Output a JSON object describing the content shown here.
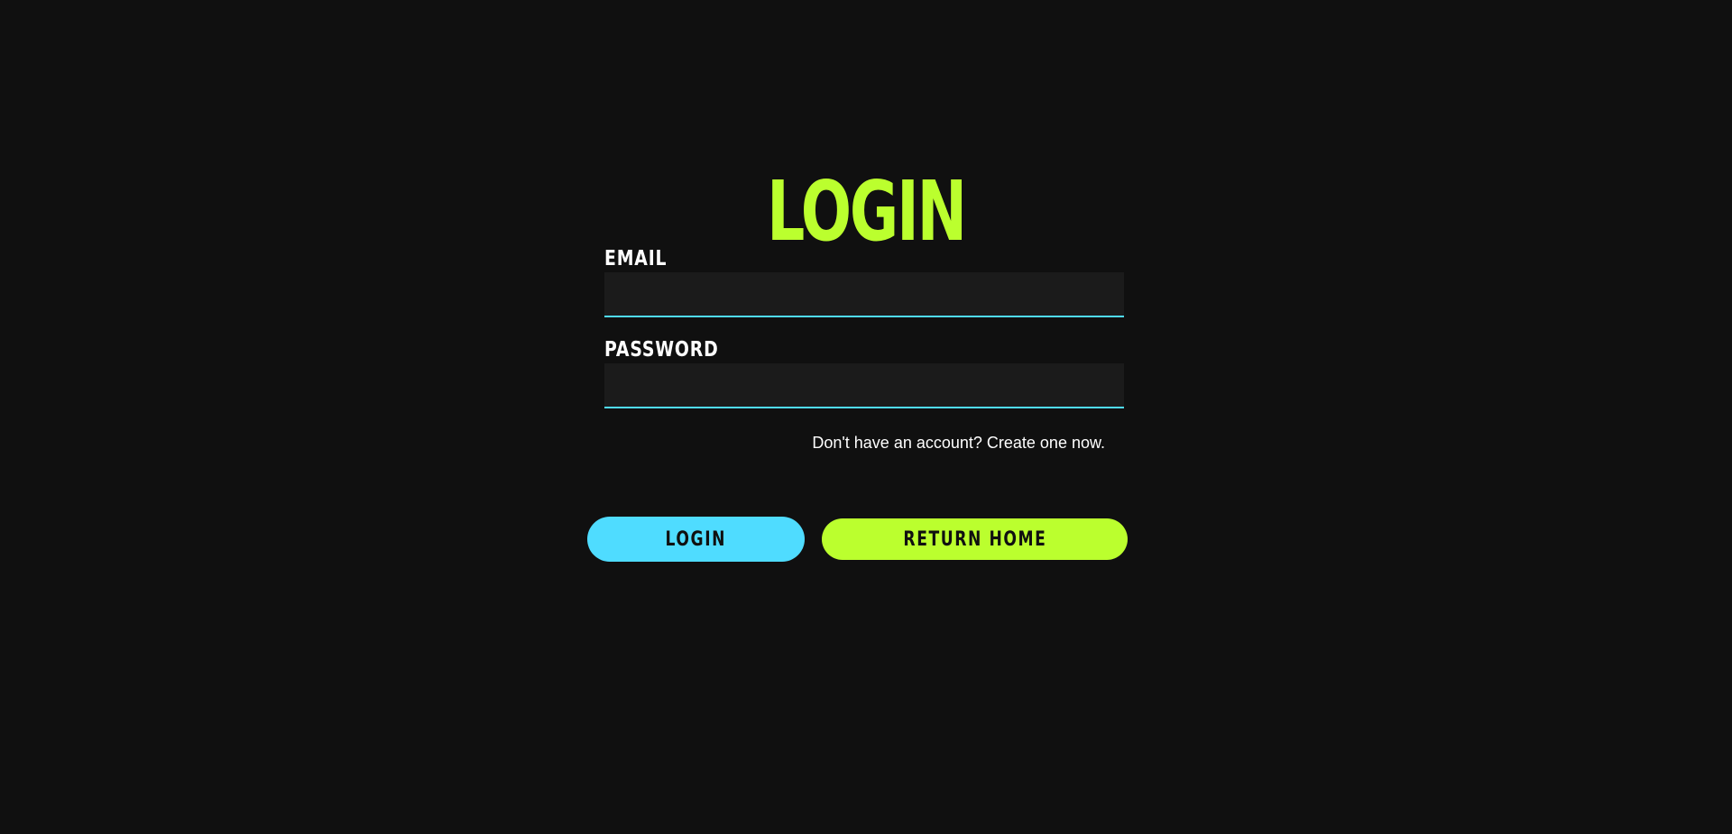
{
  "page": {
    "title": "LOGIN"
  },
  "form": {
    "email": {
      "label": "EMAIL",
      "value": "",
      "placeholder": ""
    },
    "password": {
      "label": "PASSWORD",
      "value": "",
      "placeholder": ""
    },
    "signup_text": "Don't have an account? Create one now."
  },
  "actions": {
    "login_label": "LOGIN",
    "return_home_label": "RETURN HOME"
  },
  "colors": {
    "background": "#101010",
    "accent_lime": "#bbff2e",
    "accent_cyan": "#4fdcff",
    "input_bg": "#1b1b1b"
  }
}
